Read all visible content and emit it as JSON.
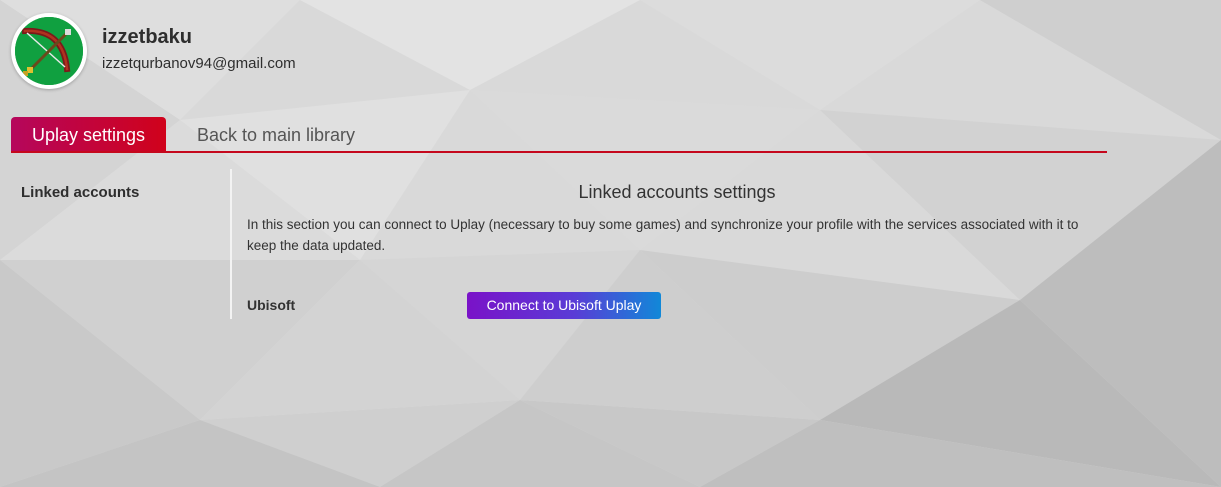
{
  "user": {
    "name": "izzetbaku",
    "email": "izzetqurbanov94@gmail.com",
    "avatar_icon": "bow-and-arrow-icon"
  },
  "tabs": [
    {
      "label": "Uplay settings",
      "active": true
    },
    {
      "label": "Back to main library",
      "active": false
    }
  ],
  "sidebar": {
    "items": [
      {
        "label": "Linked accounts"
      }
    ]
  },
  "section": {
    "title": "Linked accounts settings",
    "description": "In this section you can connect to Uplay (necessary to buy some games) and synchronize your profile with the services associated with it to keep the data updated.",
    "services": [
      {
        "label": "Ubisoft",
        "button_label": "Connect to Ubisoft Uplay"
      }
    ]
  },
  "colors": {
    "accent_red": "#c5081d",
    "tab_gradient_start": "#b5065c",
    "button_gradient_start": "#7a12c8",
    "button_gradient_end": "#1188d8",
    "avatar_bg": "#0f9f3e"
  }
}
